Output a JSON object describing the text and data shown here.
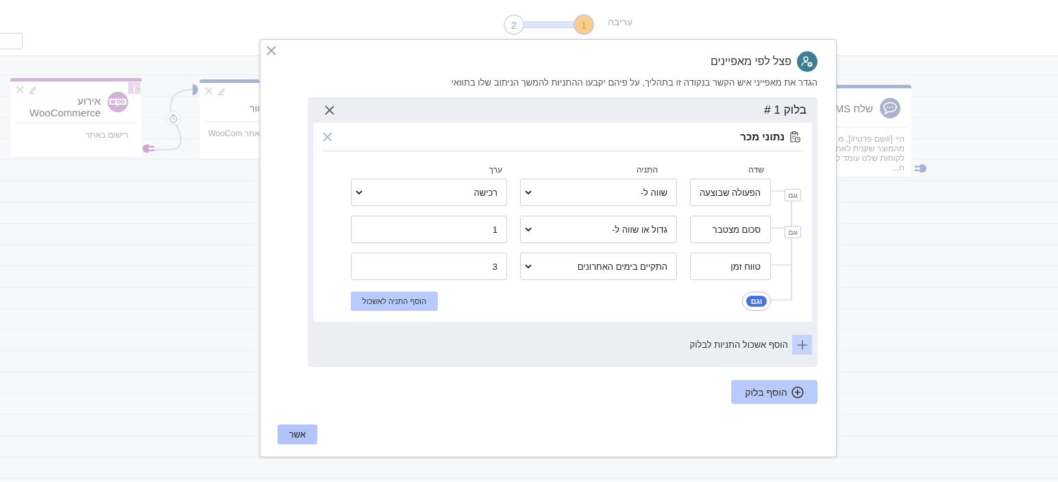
{
  "stepper": {
    "label": "עריבה",
    "steps": [
      {
        "label": "1",
        "selected": true
      },
      {
        "label": "2",
        "selected": false
      }
    ]
  },
  "canvas": {
    "nodes": [
      {
        "title": "שלח MS",
        "body": [
          "היי [#שם פרטי#], מ",
          "מהמוצר שקנית לאח",
          "לקוחות שלנו עומד ל",
          "ח..."
        ],
        "color": "#a9b2d0",
        "kind": "sms"
      },
      {
        "title": "וור",
        "body": [
          "אתר WooCom"
        ],
        "color": "#a9b2d0",
        "kind": "plain"
      },
      {
        "title": "אירוע WooCommerce",
        "body": [
          "רישום באתר"
        ],
        "color": "#d4b5d8",
        "kind": "woo"
      }
    ]
  },
  "modal": {
    "title": "פצל לפי מאפיינים",
    "description": "הגדר את מאפייני איש הקשר בנקודה זו בתהליך, על פיהם יקבעו ההתניות להמשך הניתוב שלו בתוואי",
    "blocks": [
      {
        "title": "בלוק 1 #",
        "groups": [
          {
            "title": "נתוני מכר",
            "columns": [
              "שדה",
              "התניה",
              "ערך"
            ],
            "conditions": [
              {
                "field": "הפעולה שבוצעה",
                "operator": "שווה ל-",
                "value": "רכישה",
                "kind": "select"
              },
              {
                "field": "סכום מצטבר",
                "operator": "גדול או שווה ל-",
                "value": "1",
                "kind": "input"
              },
              {
                "field": "טווח זמן",
                "operator": "התקיים בימים האחרונים",
                "value": "3",
                "kind": "input"
              }
            ],
            "joiners": [
              "וגם",
              "וגם"
            ],
            "logic_toggle": "וגם",
            "add_condition": "הוסף התניה לאשכול"
          }
        ],
        "add_group": "הוסף אשכול התניות לבלוק"
      }
    ],
    "add_block": "הוסף בלוק",
    "confirm": "אשר"
  }
}
